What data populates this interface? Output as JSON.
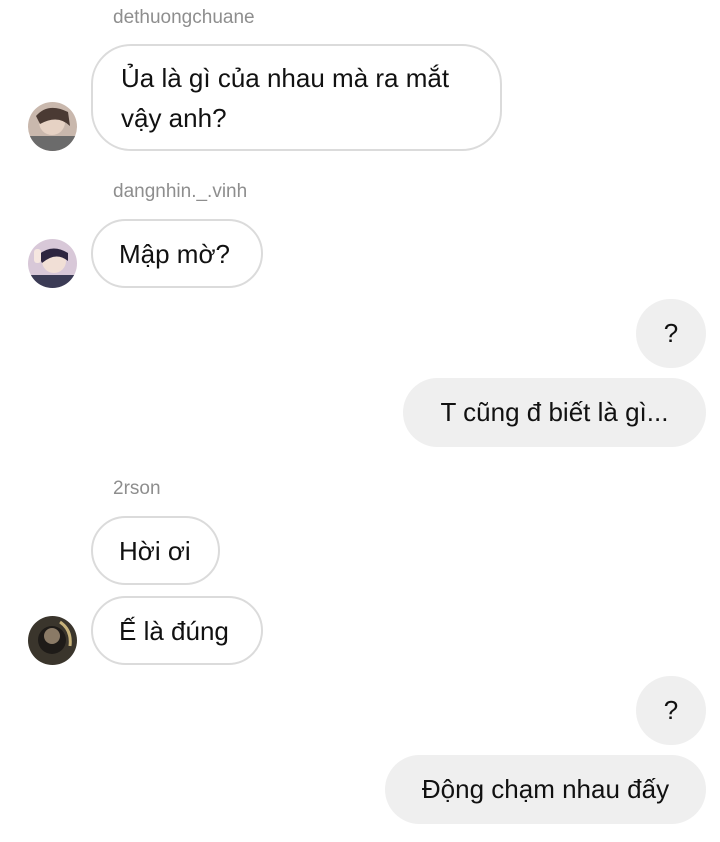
{
  "messages": [
    {
      "sender": "dethuongchuane",
      "text": "Ủa là gì của nhau mà ra mắt vậy anh?"
    },
    {
      "sender": "dangnhin._.vinh",
      "text": "Mập mờ?"
    },
    {
      "sender": "me",
      "text": "?"
    },
    {
      "sender": "me",
      "text": "T cũng đ biết là gì..."
    },
    {
      "sender": "2rson",
      "text": "Hời ơi"
    },
    {
      "sender": "2rson",
      "text": "Ế là đúng"
    },
    {
      "sender": "me",
      "text": "?"
    },
    {
      "sender": "me",
      "text": "Động chạm nhau đấy"
    }
  ],
  "usernames": {
    "u1": "dethuongchuane",
    "u2": "dangnhin._.vinh",
    "u3": "2rson"
  },
  "colors": {
    "incoming_border": "#dbdbdb",
    "outgoing_bg": "#efefef",
    "username": "#8e8e8e"
  }
}
